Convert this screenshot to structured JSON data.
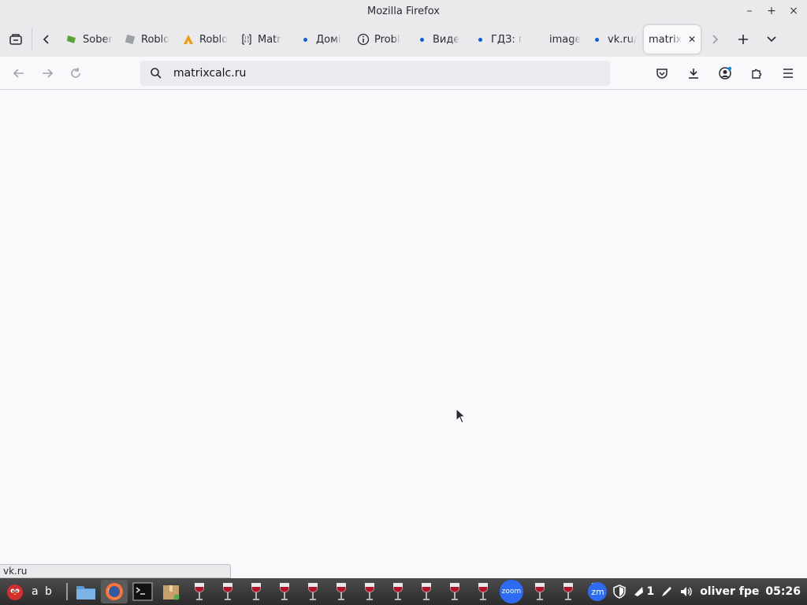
{
  "window": {
    "title": "Mozilla Firefox",
    "controls": [
      "–",
      "+",
      "×"
    ]
  },
  "tabs": [
    {
      "label": "Sober",
      "icon": "sober-icon"
    },
    {
      "label": "Roblo",
      "icon": "roblox-icon"
    },
    {
      "label": "Roblo",
      "icon": "roblox-orange-icon"
    },
    {
      "label": "Matr",
      "icon": "matrix-icon"
    },
    {
      "label": "Домі",
      "icon": "dot-icon"
    },
    {
      "label": "Probl",
      "icon": "info-icon"
    },
    {
      "label": "Виде",
      "icon": "dot-icon"
    },
    {
      "label": "ГДЗ: г",
      "icon": "dot-icon"
    },
    {
      "label": "images (",
      "icon": "none"
    },
    {
      "label": "vk.ru/",
      "icon": "dot-icon"
    },
    {
      "label": "matrix",
      "icon": "none",
      "active": true
    }
  ],
  "navbar": {
    "url": "matrixcalc.ru"
  },
  "status_link": "vk.ru",
  "taskbar": {
    "workspaces": "a b",
    "zoom_label": "zoom",
    "zm_label": "zm",
    "tray_count": "1",
    "user_label": "oliver fpe",
    "clock": "05:26"
  },
  "colors": {
    "accent": "#0060df",
    "taskbar": "#333333"
  }
}
